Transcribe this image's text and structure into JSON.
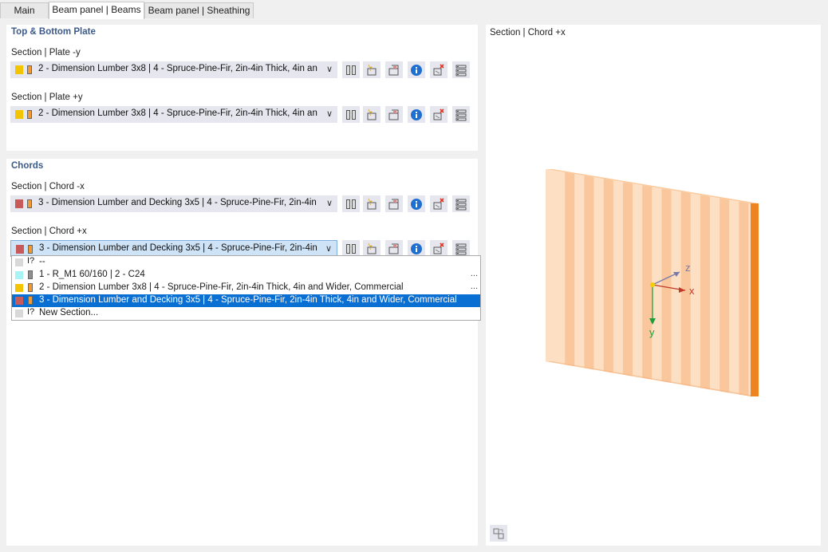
{
  "tabs": [
    {
      "label": "Main"
    },
    {
      "label": "Beam panel | Beams"
    },
    {
      "label": "Beam panel | Sheathing"
    }
  ],
  "top_bottom": {
    "title": "Top & Bottom Plate",
    "plate_minus_y": {
      "label": "Section | Plate -y",
      "value": "2 - Dimension Lumber 3x8 | 4 - Spruce-Pine-Fir, 2in-4in Thick, 4in an...",
      "color1": "#f2c500",
      "color2": "#f29a30"
    },
    "plate_plus_y": {
      "label": "Section | Plate +y",
      "value": "2 - Dimension Lumber 3x8 | 4 - Spruce-Pine-Fir, 2in-4in Thick, 4in an...",
      "color1": "#f2c500",
      "color2": "#f29a30"
    }
  },
  "chords": {
    "title": "Chords",
    "chord_minus_x": {
      "label": "Section | Chord -x",
      "value": "3 - Dimension Lumber and Decking 3x5 | 4 - Spruce-Pine-Fir, 2in-4in ...",
      "color1": "#c85a5a",
      "color2": "#f29a30"
    },
    "chord_plus_x": {
      "label": "Section | Chord +x",
      "value": "3 - Dimension Lumber and Decking 3x5 | 4 - Spruce-Pine-Fir, 2in-4in ...",
      "color1": "#c85a5a",
      "color2": "#f29a30"
    }
  },
  "dropdown": {
    "options": [
      {
        "text": "--",
        "color1": "#d8d8d8",
        "icon": "new-section-icon"
      },
      {
        "text": "1 - R_M1 60/160 | 2 - C24",
        "color1": "#a8f4f4",
        "color2": "#909090",
        "more": "..."
      },
      {
        "text": "2 - Dimension Lumber 3x8 | 4 - Spruce-Pine-Fir, 2in-4in Thick, 4in and Wider, Commercial",
        "color1": "#f2c500",
        "color2": "#f29a30",
        "more": "..."
      },
      {
        "text": "3 - Dimension Lumber and Decking 3x5 | 4 - Spruce-Pine-Fir, 2in-4in Thick, 4in and Wider, Commercial",
        "color1": "#c85a5a",
        "color2": "#f29a30"
      },
      {
        "text": "New Section...",
        "color1": "#d8d8d8",
        "icon": "new-section-icon"
      }
    ]
  },
  "preview": {
    "title": "Section | Chord +x",
    "axes": {
      "x": "x",
      "y": "y",
      "z": "z"
    }
  },
  "colors": {
    "accent": "#0a6fd3",
    "group_title": "#3b5a8a",
    "wood_light": "#fcd9b8",
    "wood_dark": "#f08a2a"
  }
}
